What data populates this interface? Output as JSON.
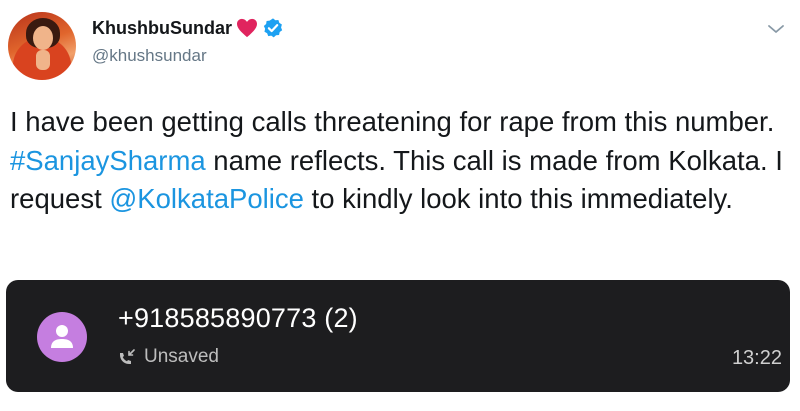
{
  "author": {
    "display_name": "KhushbuSundar",
    "handle": "@khushsundar",
    "avatar_icon": "profile-photo",
    "heart_color": "#e0245e",
    "verified_color": "#1da1f2"
  },
  "tweet": {
    "segments": [
      {
        "type": "text",
        "value": "I have been getting calls threatening for rape from this number. "
      },
      {
        "type": "link",
        "value": "#SanjaySharma"
      },
      {
        "type": "text",
        "value": " name reflects. This call is made from Kolkata. I request "
      },
      {
        "type": "link",
        "value": "@KolkataPolice"
      },
      {
        "type": "text",
        "value": " to kindly look into this immediately."
      }
    ],
    "link_color": "#1b95e0"
  },
  "call_card": {
    "number": "+918585890773 (2)",
    "status": "Unsaved",
    "time": "13:22",
    "avatar_color": "#c57ee0",
    "background": "#1d1d1f"
  },
  "menu": {
    "icon": "chevron-down-icon"
  }
}
